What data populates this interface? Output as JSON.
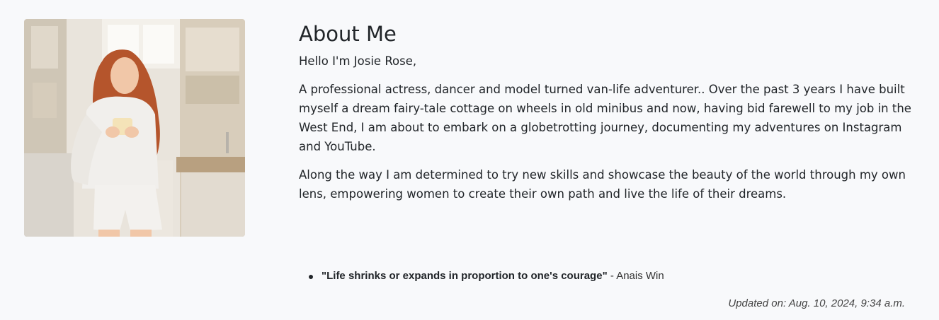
{
  "profile": {
    "photo_alt": "Josie Rose"
  },
  "about": {
    "heading": "About Me",
    "greeting": "Hello I'm Josie Rose,",
    "paragraphs": [
      "A professional actress, dancer and model turned van-life adventurer.. Over the past 3 years I have built myself a dream fairy-tale cottage on wheels in old minibus and now, having bid farewell to my job in the West End, I am about to embark on a globetrotting journey, documenting my adventures on Instagram and YouTube.",
      "Along the way I am determined to try new skills and showcase the beauty of the world through my own lens, empowering women to create their own path and live the life of their dreams."
    ]
  },
  "quotes": [
    {
      "text": "\"Life shrinks or expands in proportion to one's courage\"",
      "author": "- Anais Win"
    }
  ],
  "footer": {
    "updated": "Updated on: Aug. 10, 2024, 9:34 a.m."
  }
}
